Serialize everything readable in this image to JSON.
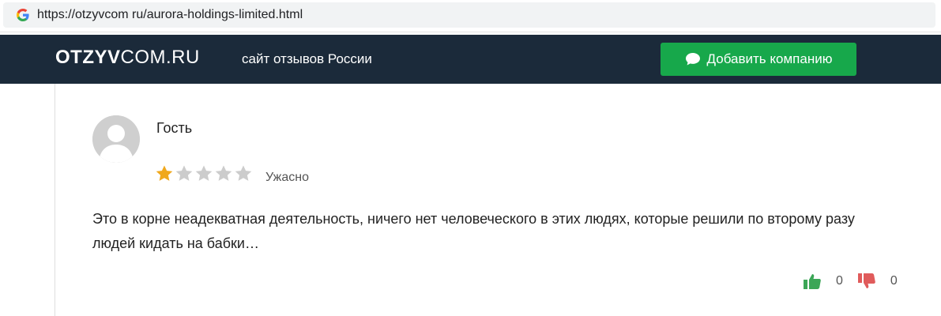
{
  "browser": {
    "url": "https://otzyvcom ru/aurora-holdings-limited.html",
    "favicon_icon": "google-g-icon"
  },
  "header": {
    "logo_bold": "OTZYV",
    "logo_light": "COM.RU",
    "tagline": "сайт отзывов России",
    "add_company_label": "Добавить компанию",
    "add_company_icon": "speech-bubble-icon",
    "background_color": "#1b2a3a",
    "button_color": "#17a84b"
  },
  "review": {
    "avatar_icon": "user-avatar-icon",
    "author": "Гость",
    "rating": 1,
    "rating_max": 5,
    "rating_label": "Ужасно",
    "star_filled_color": "#f0a81c",
    "star_empty_color": "#cccccc",
    "text": "Это в корне неадекватная деятельность, ничего нет человеческого в этих людях, которые решили по второму разу людей кидать на бабки…",
    "likes": "0",
    "dislikes": "0",
    "like_icon": "thumbs-up-icon",
    "dislike_icon": "thumbs-down-icon"
  }
}
